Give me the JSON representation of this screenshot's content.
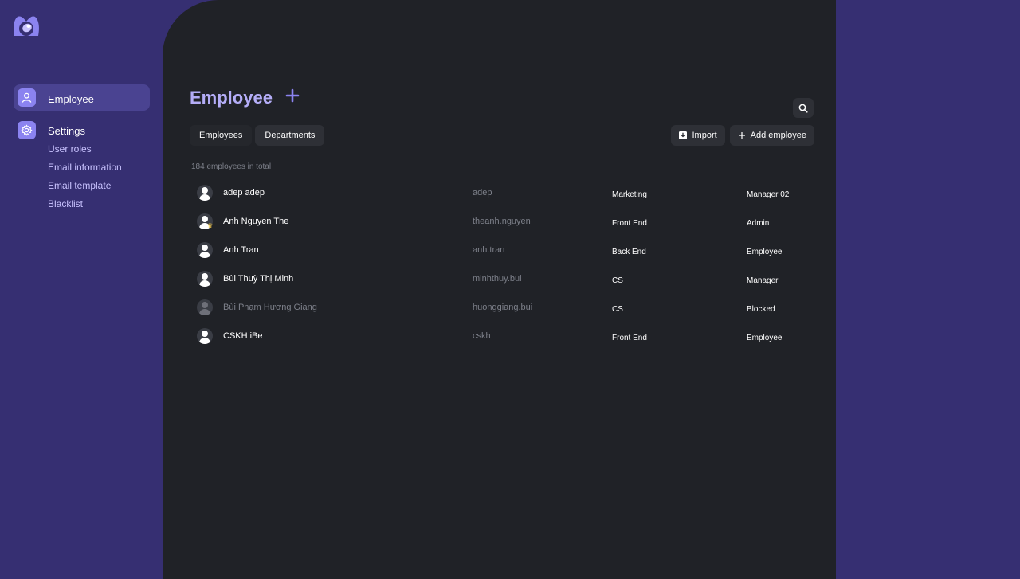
{
  "brand": {
    "accent": "#8b83f0",
    "background": "#362f72",
    "panel": "#202227"
  },
  "sidebar": {
    "items": [
      {
        "label": "Employee",
        "icon": "user-icon",
        "active": true
      },
      {
        "label": "Settings",
        "icon": "gear-icon",
        "active": false
      }
    ],
    "settings_sub": [
      "User roles",
      "Email information",
      "Email template",
      "Blacklist"
    ]
  },
  "main": {
    "title": "Employee",
    "tabs": [
      "Employees",
      "Departments"
    ],
    "actions": {
      "import": "Import",
      "add": "Add employee"
    },
    "total": "184 employees in total",
    "rows": [
      {
        "name": "adep adep",
        "username": "adep",
        "department": "Marketing",
        "role": "Manager 02",
        "crown": false,
        "blocked": false
      },
      {
        "name": "Anh Nguyen The",
        "username": "theanh.nguyen",
        "department": "Front End",
        "role": "Admin",
        "crown": true,
        "blocked": false
      },
      {
        "name": "Anh Tran",
        "username": "anh.tran",
        "department": "Back End",
        "role": "Employee",
        "crown": false,
        "blocked": false
      },
      {
        "name": "Bùi Thuỳ Thị Minh",
        "username": "minhthuy.bui",
        "department": "CS",
        "role": "Manager",
        "crown": false,
        "blocked": false
      },
      {
        "name": "Bùi Phạm Hương Giang",
        "username": "huonggiang.bui",
        "department": "CS",
        "role": "Blocked",
        "crown": false,
        "blocked": true
      },
      {
        "name": "CSKH iBe",
        "username": "cskh",
        "department": "Front End",
        "role": "Employee",
        "crown": false,
        "blocked": false
      }
    ]
  }
}
